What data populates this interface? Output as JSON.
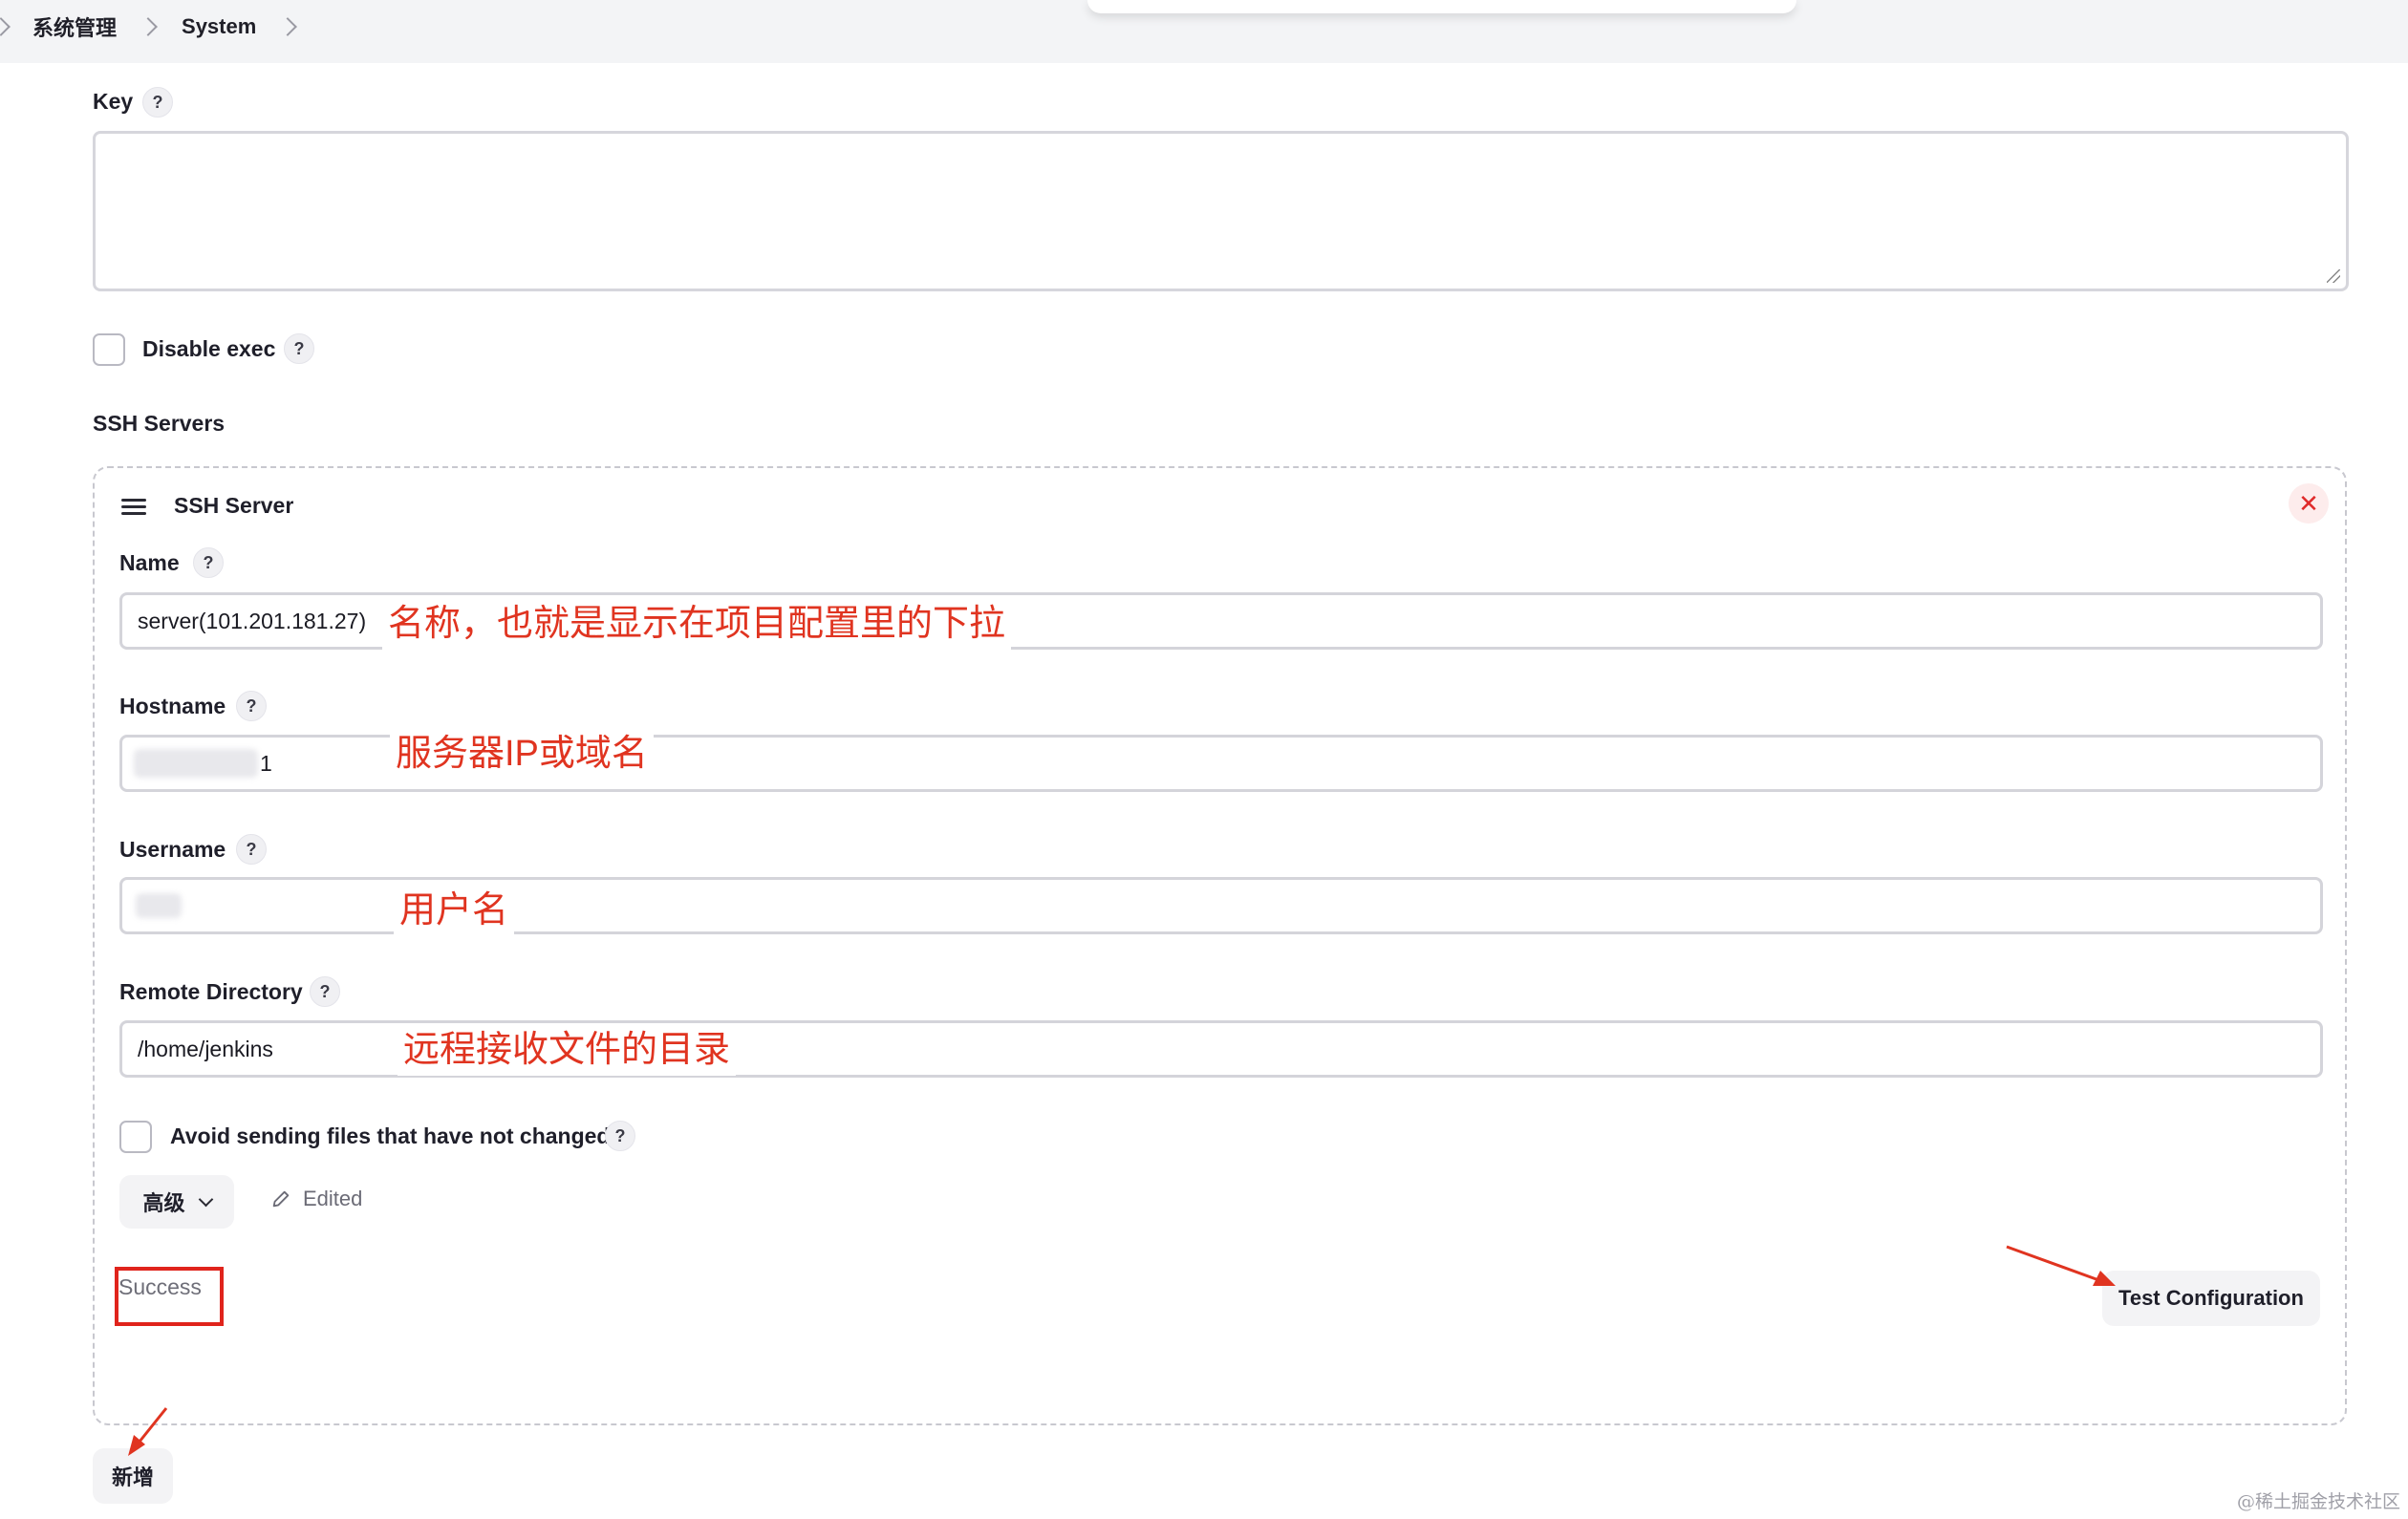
{
  "breadcrumb": [
    "系统管理",
    "System"
  ],
  "fields": {
    "key_label": "Key",
    "disable_exec_label": "Disable exec",
    "ssh_servers_label": "SSH Servers"
  },
  "ssh_server": {
    "title": "SSH Server",
    "name_label": "Name",
    "name_value": "server(101.201.181.27)",
    "hostname_label": "Hostname",
    "hostname_value_visible": "1",
    "username_label": "Username",
    "remote_dir_label": "Remote Directory",
    "remote_dir_value": "/home/jenkins",
    "avoid_label": "Avoid sending files that have not changed",
    "advanced_label": "高级",
    "edited_label": "Edited",
    "status_text": "Success",
    "test_button": "Test Configuration"
  },
  "annotations": {
    "name": "名称，也就是显示在项目配置里的下拉",
    "hostname": "服务器IP或域名",
    "username": "用户名",
    "remote_dir": "远程接收文件的目录"
  },
  "help_glyph": "?",
  "close_glyph": "✕",
  "add_button": "新增",
  "watermark": "@稀土掘金技术社区",
  "colors": {
    "annotation": "#e03420",
    "danger": "#e02b2b"
  }
}
